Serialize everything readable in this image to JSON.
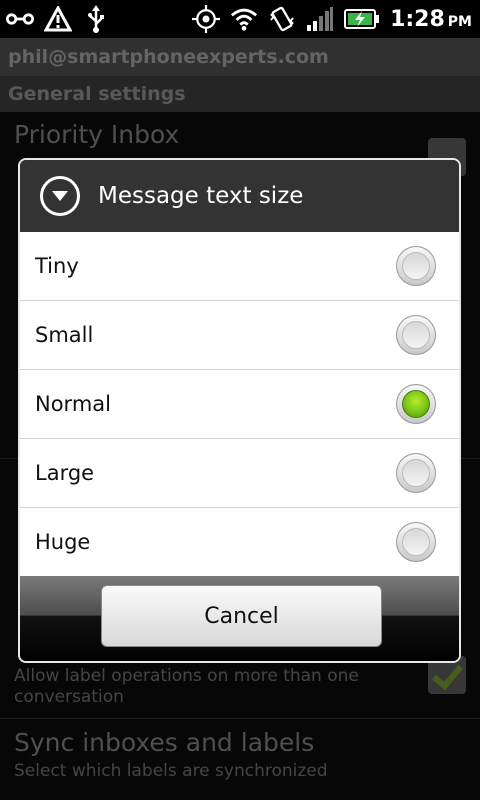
{
  "status_bar": {
    "icons_left": [
      "link-icon",
      "warning-icon",
      "usb-icon"
    ],
    "icons_right": [
      "gps-icon",
      "wifi-icon",
      "vibrate-icon",
      "signal-icon",
      "battery-charging-icon"
    ],
    "time": "1:28",
    "ampm": "PM"
  },
  "background": {
    "account": "phil@smartphoneexperts.com",
    "section": "General settings",
    "priority_inbox_title": "Priority Inbox",
    "label_ops_summary_1": "Allow label operations on more than one",
    "label_ops_summary_2": "conversation",
    "sync_title": "Sync inboxes and labels",
    "sync_summary": "Select which labels are synchronized"
  },
  "dialog": {
    "title": "Message text size",
    "options": [
      {
        "label": "Tiny",
        "selected": false
      },
      {
        "label": "Small",
        "selected": false
      },
      {
        "label": "Normal",
        "selected": true
      },
      {
        "label": "Large",
        "selected": false
      },
      {
        "label": "Huge",
        "selected": false
      }
    ],
    "cancel_label": "Cancel"
  },
  "colors": {
    "selected_radio": "#8fd11f",
    "dialog_header": "#333333",
    "dialog_border": "#e8e8e8"
  }
}
